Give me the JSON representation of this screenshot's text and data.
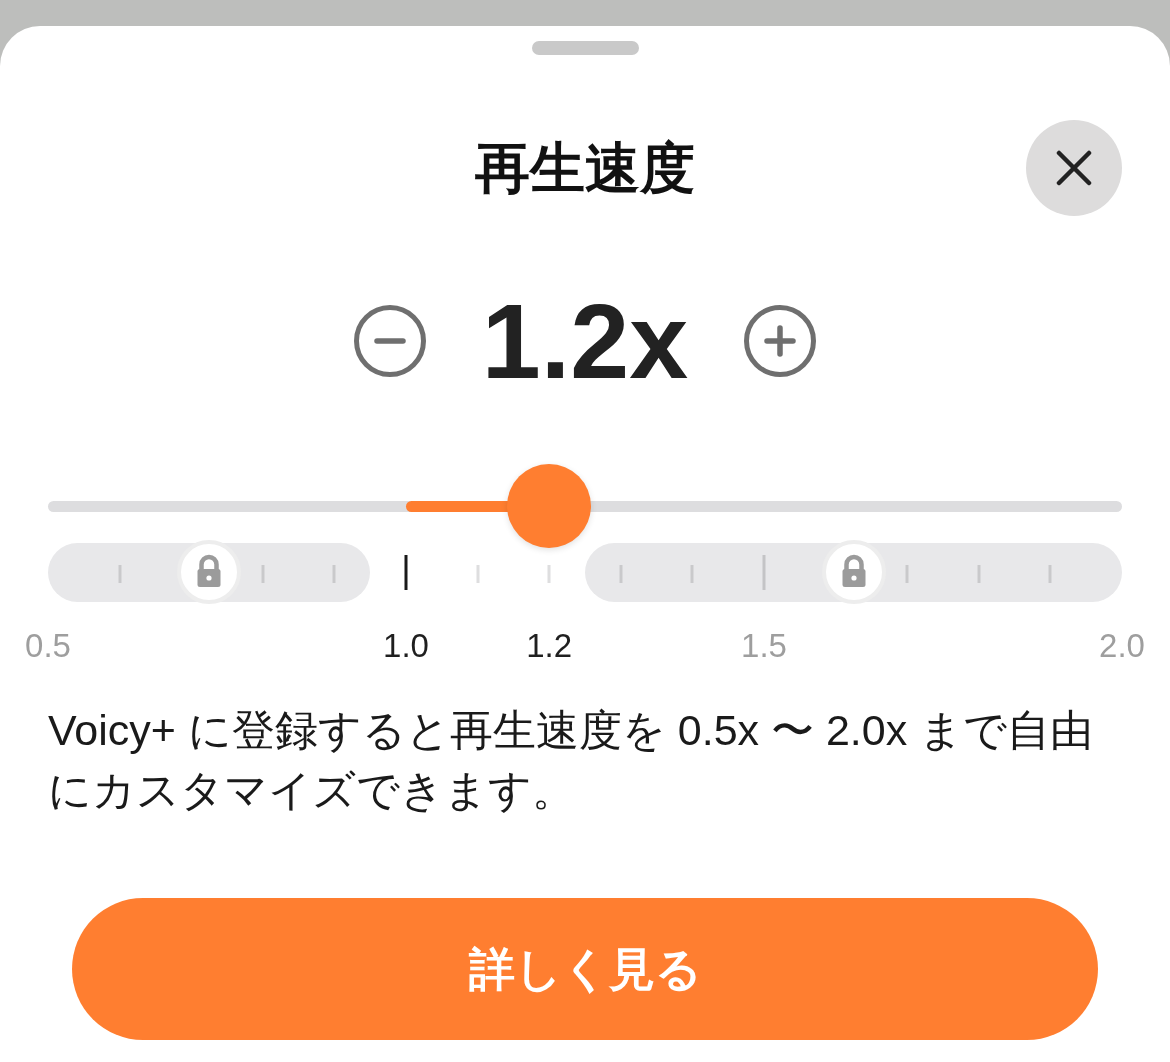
{
  "title": "再生速度",
  "speed": {
    "value": "1.2x"
  },
  "slider": {
    "level": 0.4667,
    "segments": [
      {
        "kind": "locked",
        "steps": [
          {
            "kind": "end",
            "label": "0.5"
          },
          {
            "kind": "minor"
          },
          {
            "kind": "lock"
          },
          {
            "kind": "minor"
          },
          {
            "kind": "minor"
          }
        ]
      },
      {
        "kind": "free",
        "steps": [
          {
            "kind": "major",
            "label": "1.0"
          },
          {
            "kind": "minor"
          },
          {
            "kind": "minor",
            "label": "1.2"
          }
        ]
      },
      {
        "kind": "locked",
        "steps": [
          {
            "kind": "minor"
          },
          {
            "kind": "minor"
          },
          {
            "kind": "major",
            "label": "1.5"
          },
          {
            "kind": "lock"
          },
          {
            "kind": "minor"
          },
          {
            "kind": "minor"
          },
          {
            "kind": "minor"
          },
          {
            "kind": "end",
            "label": "2.0"
          }
        ]
      }
    ]
  },
  "description": "Voicy+ に登録すると再生速度を 0.5x 〜 2.0x まで自由にカスタマイズできます。",
  "button": {
    "label": "詳しく見る"
  }
}
